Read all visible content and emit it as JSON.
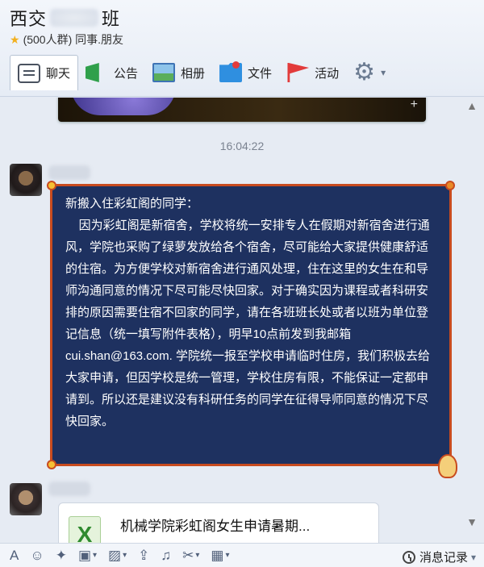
{
  "header": {
    "title_left": "西交",
    "title_right": "班",
    "subtitle": "(500人群) 同事.朋友"
  },
  "toolbar": {
    "chat": "聊天",
    "notice": "公告",
    "album": "相册",
    "file": "文件",
    "activity": "活动"
  },
  "chat": {
    "time": "16:04:22",
    "notice_text": "新搬入住彩虹阁的同学：\n    因为彩虹阁是新宿舍，学校将统一安排专人在假期对新宿舍进行通风，学院也采购了绿萝发放给各个宿舍，尽可能给大家提供健康舒适的住宿。为方便学校对新宿舍进行通风处理，住在这里的女生在和导师沟通同意的情况下尽可能尽快回家。对于确实因为课程或者科研安排的原因需要住宿不回家的同学，请在各班班长处或者以班为单位登记信息（统一填写附件表格），明早10点前发到我邮箱cui.shan@163.com. 学院统一报至学校申请临时住房，我们积极去给大家申请，但因学校是统一管理，学校住房有限，不能保证一定都申请到。所以还是建议没有科研任务的同学在征得导师同意的情况下尽快回家。",
    "file_name": "机械学院彩虹阁女生申请暑期..."
  },
  "input_bar": {
    "history": "消息记录"
  },
  "colors": {
    "notice_bg": "#1e3160",
    "notice_border": "#c84b1f"
  }
}
